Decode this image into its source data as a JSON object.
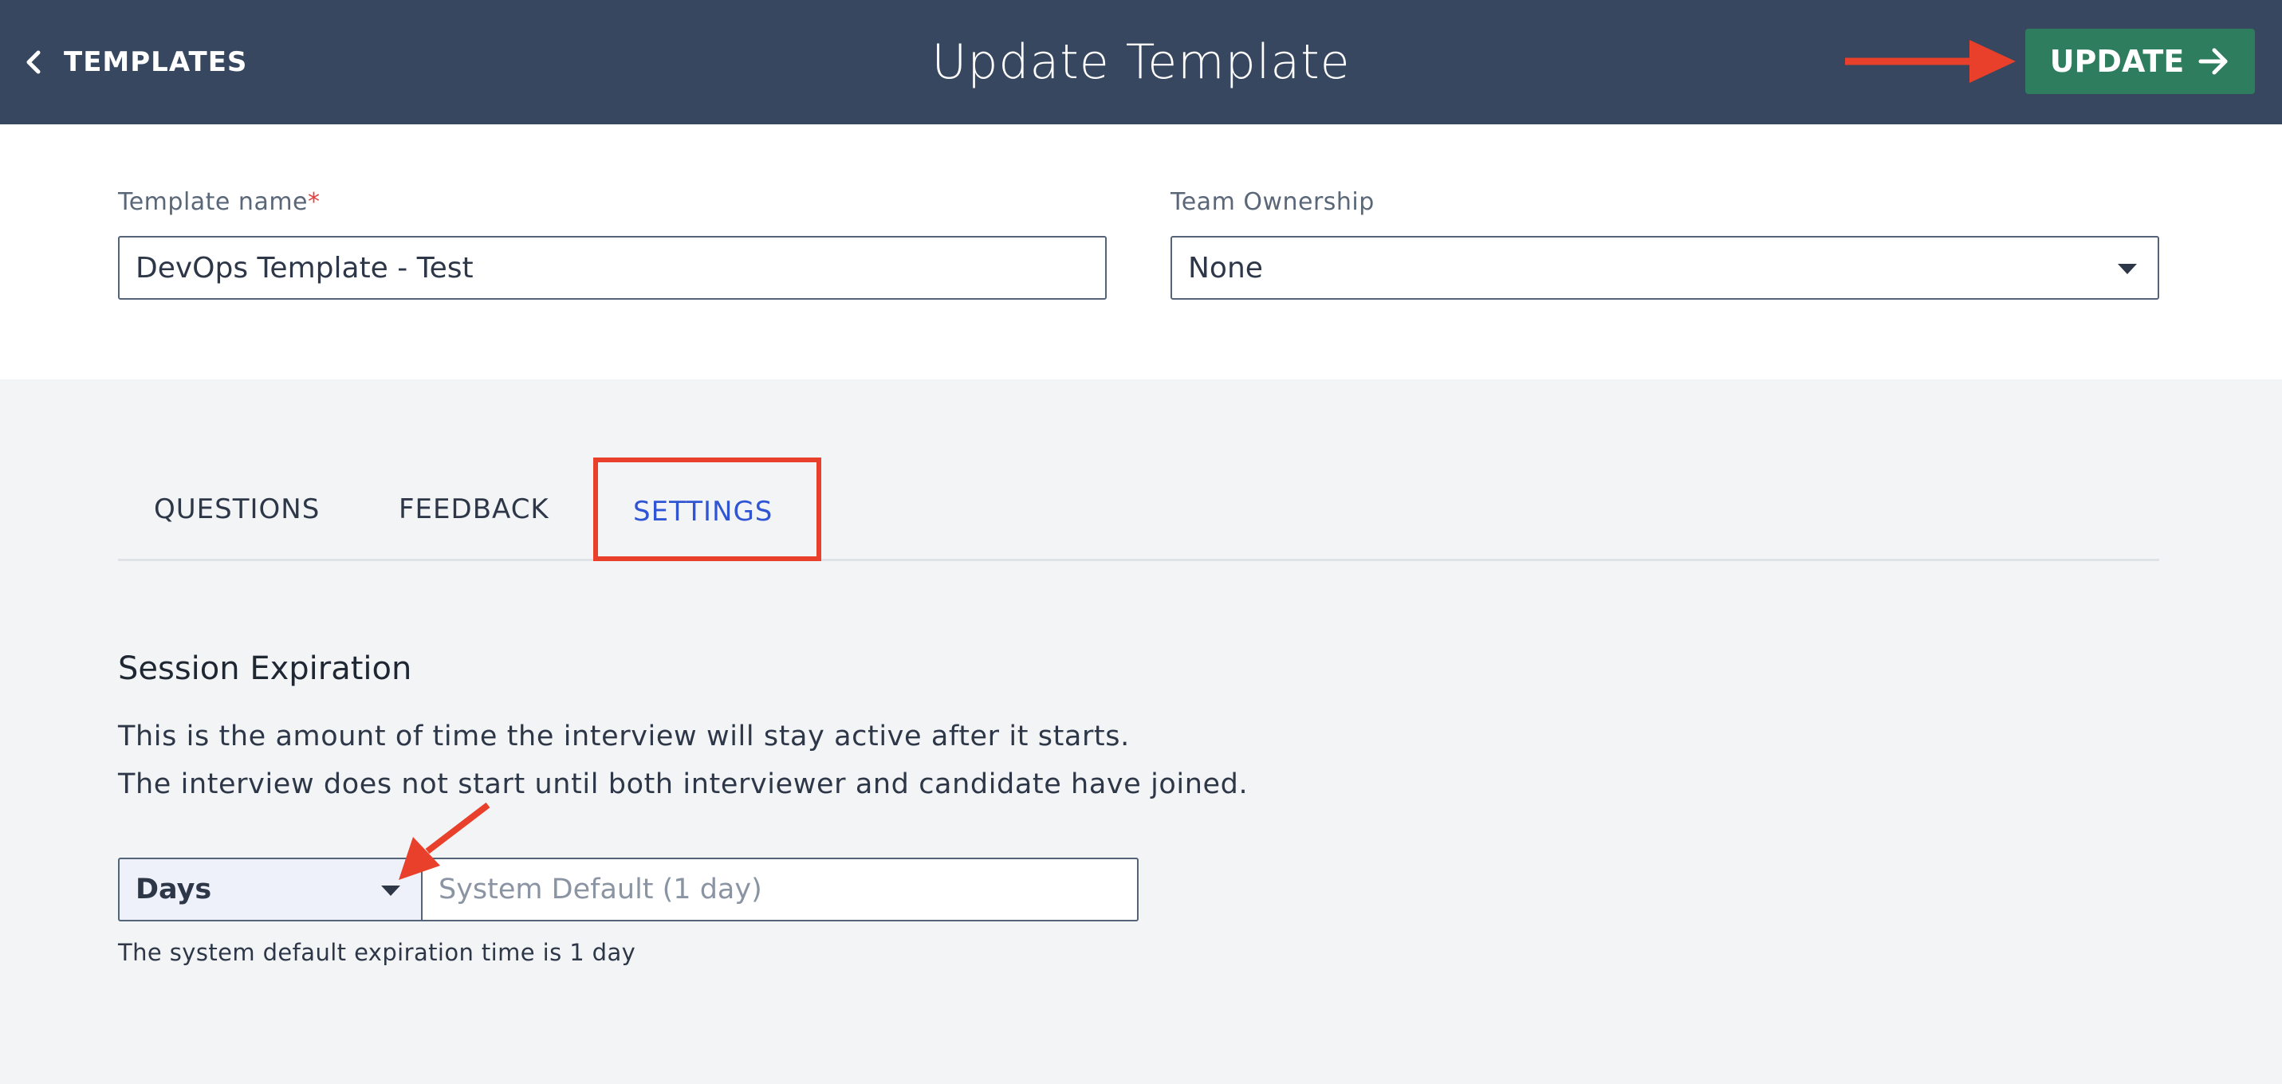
{
  "header": {
    "back_label": "TEMPLATES",
    "title": "Update Template",
    "update_label": "UPDATE"
  },
  "form": {
    "template_name_label": "Template name",
    "required_mark": "*",
    "template_name_value": "DevOps Template - Test",
    "team_ownership_label": "Team Ownership",
    "team_ownership_value": "None"
  },
  "tabs": [
    {
      "label": "QUESTIONS",
      "active": false
    },
    {
      "label": "FEEDBACK",
      "active": false
    },
    {
      "label": "SETTINGS",
      "active": true
    }
  ],
  "settings": {
    "section_title": "Session Expiration",
    "description_line1": "This is the amount of time the interview will stay active after it starts.",
    "description_line2": "The interview does not start until both interviewer and candidate have joined.",
    "unit_value": "Days",
    "duration_placeholder": "System Default (1 day)",
    "help_text": "The system default expiration time is 1 day"
  },
  "colors": {
    "header_bg": "#36475f",
    "update_button": "#2f7d5f",
    "active_tab": "#2f55d4",
    "annotation_red": "#e8402a"
  }
}
